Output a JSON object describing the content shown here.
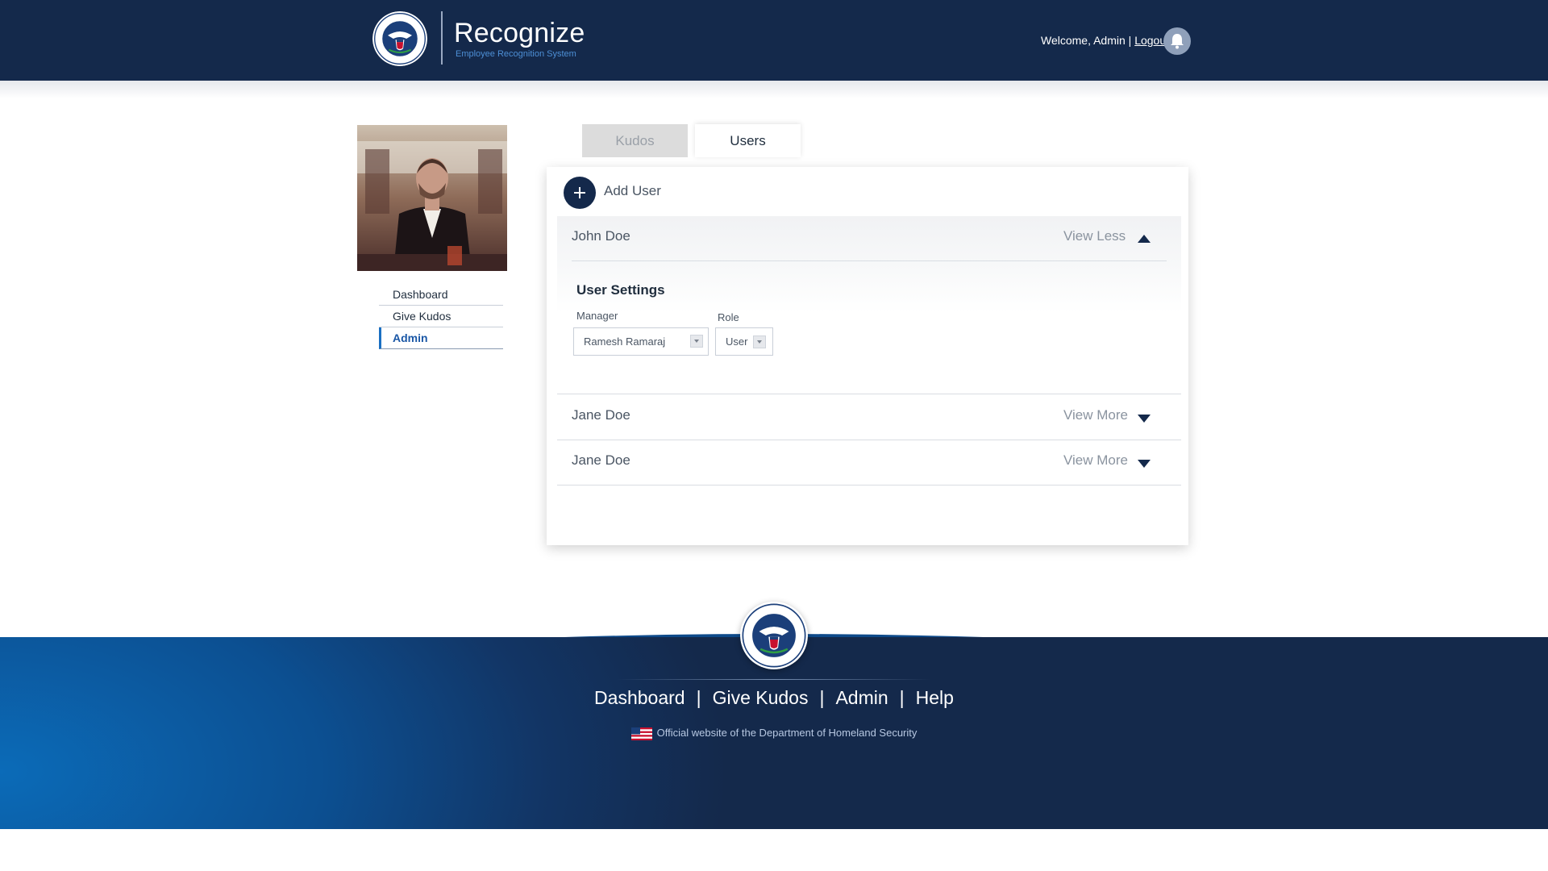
{
  "header": {
    "app_title": "Recognize",
    "app_subtitle": "Employee Recognition System",
    "welcome_text": "Welcome, Admin | ",
    "logout_label": "Logout",
    "notification_icon": "bell-icon"
  },
  "sidebar": {
    "items": [
      {
        "label": "Dashboard",
        "active": false
      },
      {
        "label": "Give Kudos",
        "active": false
      },
      {
        "label": "Admin",
        "active": true
      }
    ]
  },
  "tabs": [
    {
      "label": "Kudos",
      "active": false
    },
    {
      "label": "Users",
      "active": true
    }
  ],
  "users_panel": {
    "add_user_label": "Add User",
    "users": [
      {
        "name": "John Doe",
        "toggle_label": "View Less",
        "expanded": true
      },
      {
        "name": "Jane Doe",
        "toggle_label": "View More",
        "expanded": false
      },
      {
        "name": "Jane Doe",
        "toggle_label": "View More",
        "expanded": false
      }
    ],
    "settings": {
      "title": "User Settings",
      "manager_label": "Manager",
      "manager_value": "Ramesh Ramaraj",
      "role_label": "Role",
      "role_value": "User"
    }
  },
  "footer": {
    "links": [
      "Dashboard",
      "Give Kudos",
      "Admin",
      "Help"
    ],
    "official_text": "Official website of the Department of Homeland Security"
  },
  "colors": {
    "header_bg": "#14294b",
    "accent_blue": "#1a6fc2",
    "footer_blue": "#0b6bb8",
    "tab_inactive_bg": "#dcdcdc"
  }
}
